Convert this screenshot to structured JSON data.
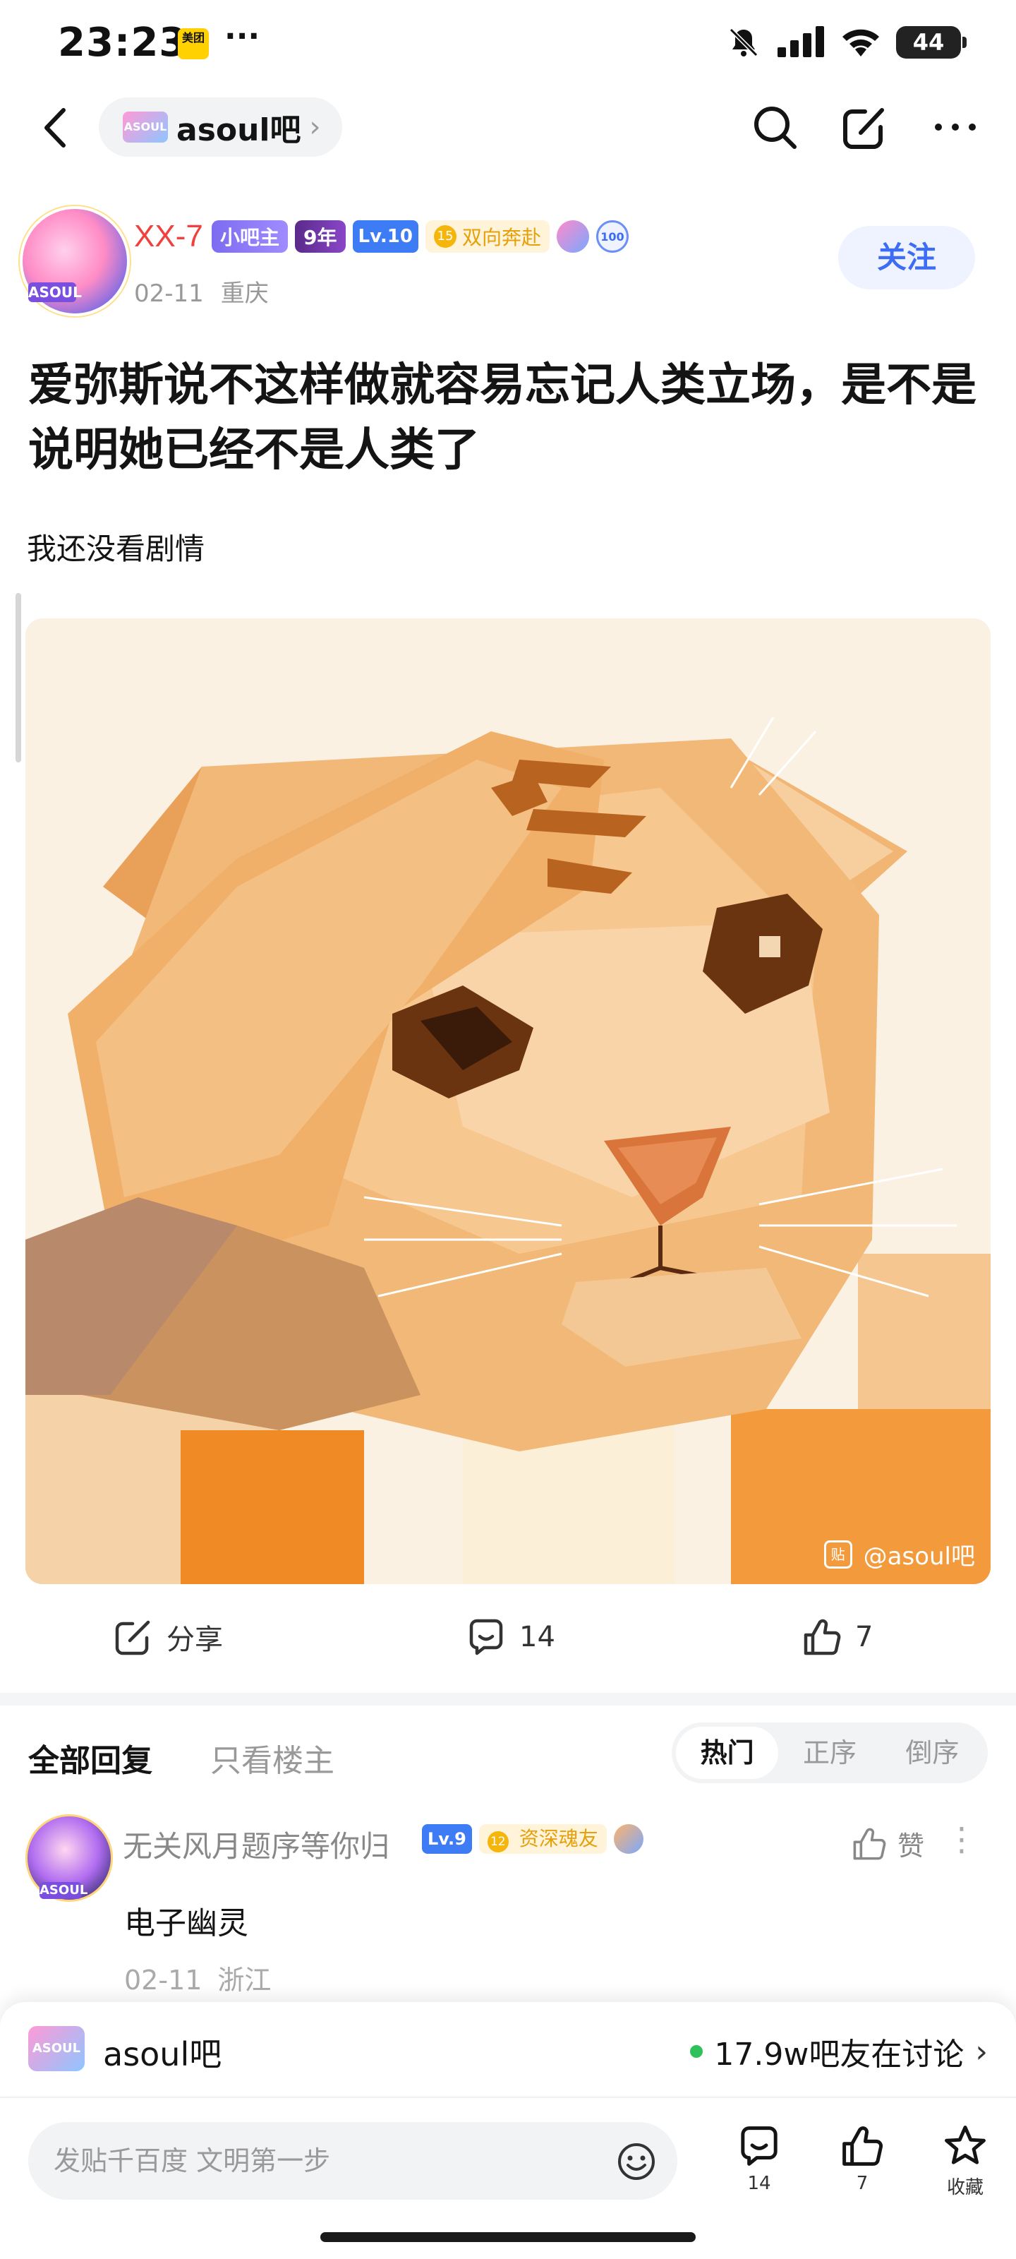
{
  "status_bar": {
    "time": "23:23",
    "app_badge": "美团",
    "dots": "···",
    "battery": "44"
  },
  "nav": {
    "forum_name": "asoul吧",
    "forum_logo_text": "ASOUL",
    "chevron": "›"
  },
  "author": {
    "name": "XX-7",
    "avatar_tag": "ASOUL",
    "badges": {
      "mod": "小吧主",
      "years": "9年",
      "level": "Lv.10",
      "friend": "双向奔赴",
      "friend_num": "15",
      "round2": "100"
    },
    "date": "02-11",
    "location": "重庆",
    "follow_label": "关注"
  },
  "post": {
    "title": "爱弥斯说不这样做就容易忘记人类立场，是不是说明她已经不是人类了",
    "body": "我还没看剧情",
    "image_watermark": "@asoul吧",
    "watermark_icon": "贴"
  },
  "actions": {
    "share_label": "分享",
    "comment_count": "14",
    "like_count": "7"
  },
  "replies": {
    "tab_all": "全部回复",
    "tab_op": "只看楼主",
    "sort_options": [
      "热门",
      "正序",
      "倒序"
    ],
    "sort_active": "热门"
  },
  "comment": {
    "user": "无关风月题序等你归",
    "avatar_tag": "ASOUL",
    "level": "Lv.9",
    "friend_num": "12",
    "friend": "资深魂友",
    "like_label": "赞",
    "more": "⋮",
    "text": "电子幽灵",
    "date": "02-11",
    "location": "浙江"
  },
  "forum_banner": {
    "logo_text": "ASOUL",
    "name": "asoul吧",
    "discussing": "17.9w吧友在讨论",
    "chevron": "›"
  },
  "bottom_bar": {
    "input_placeholder": "发贴千百度 文明第一步",
    "comment_count": "14",
    "like_count": "7",
    "collect_label": "收藏"
  },
  "colors": {
    "accent_blue": "#3d6cf5",
    "author_red": "#f0413e",
    "online_green": "#2fc25b"
  },
  "icons": [
    "back-icon",
    "search-icon",
    "edit-icon",
    "more-icon",
    "share-icon",
    "comment-icon",
    "like-icon",
    "emoji-icon",
    "star-icon"
  ]
}
